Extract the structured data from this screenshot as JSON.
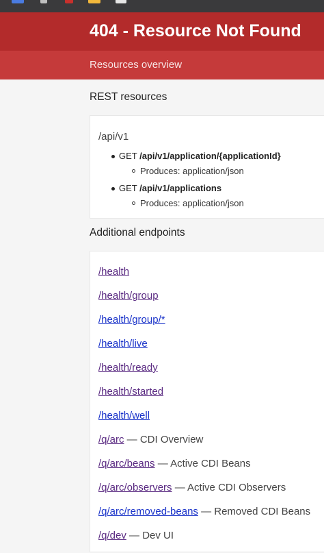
{
  "browser": {
    "tab_icons": [
      {
        "name": "tab-favicon-blue",
        "color": "#4a7be0"
      },
      {
        "name": "tab-favicon-gray",
        "color": "#bfbfbf"
      },
      {
        "name": "tab-favicon-red",
        "color": "#c8302c"
      },
      {
        "name": "tab-favicon-yellow",
        "color": "#f3b83b"
      },
      {
        "name": "tab-favicon-white",
        "color": "#e6e6e6"
      }
    ]
  },
  "header": {
    "title": "404 - Resource Not Found"
  },
  "subheader": {
    "label": "Resources overview"
  },
  "rest": {
    "title": "REST resources",
    "root": "/api/v1",
    "items": [
      {
        "method": "GET",
        "path": "/api/v1/application/{applicationId}",
        "produces": "Produces: application/json"
      },
      {
        "method": "GET",
        "path": "/api/v1/applications",
        "produces": "Produces: application/json"
      }
    ]
  },
  "additional": {
    "title": "Additional endpoints",
    "endpoints": [
      {
        "path": "/health",
        "desc": "",
        "visited": true
      },
      {
        "path": "/health/group",
        "desc": "",
        "visited": true
      },
      {
        "path": "/health/group/*",
        "desc": "",
        "visited": false
      },
      {
        "path": "/health/live",
        "desc": "",
        "visited": false
      },
      {
        "path": "/health/ready",
        "desc": "",
        "visited": true
      },
      {
        "path": "/health/started",
        "desc": "",
        "visited": true
      },
      {
        "path": "/health/well",
        "desc": "",
        "visited": false
      },
      {
        "path": "/q/arc",
        "desc": " — CDI Overview",
        "visited": true
      },
      {
        "path": "/q/arc/beans",
        "desc": " — Active CDI Beans",
        "visited": true
      },
      {
        "path": "/q/arc/observers",
        "desc": " — Active CDI Observers",
        "visited": true
      },
      {
        "path": "/q/arc/removed-beans",
        "desc": " — Removed CDI Beans",
        "visited": false
      },
      {
        "path": "/q/dev",
        "desc": " — Dev UI",
        "visited": true
      }
    ]
  },
  "colors": {
    "header_bg": "#b32b2b",
    "subheader_bg": "#c53a3a",
    "visited_link": "#5a2a82",
    "link": "#1a33c9"
  }
}
